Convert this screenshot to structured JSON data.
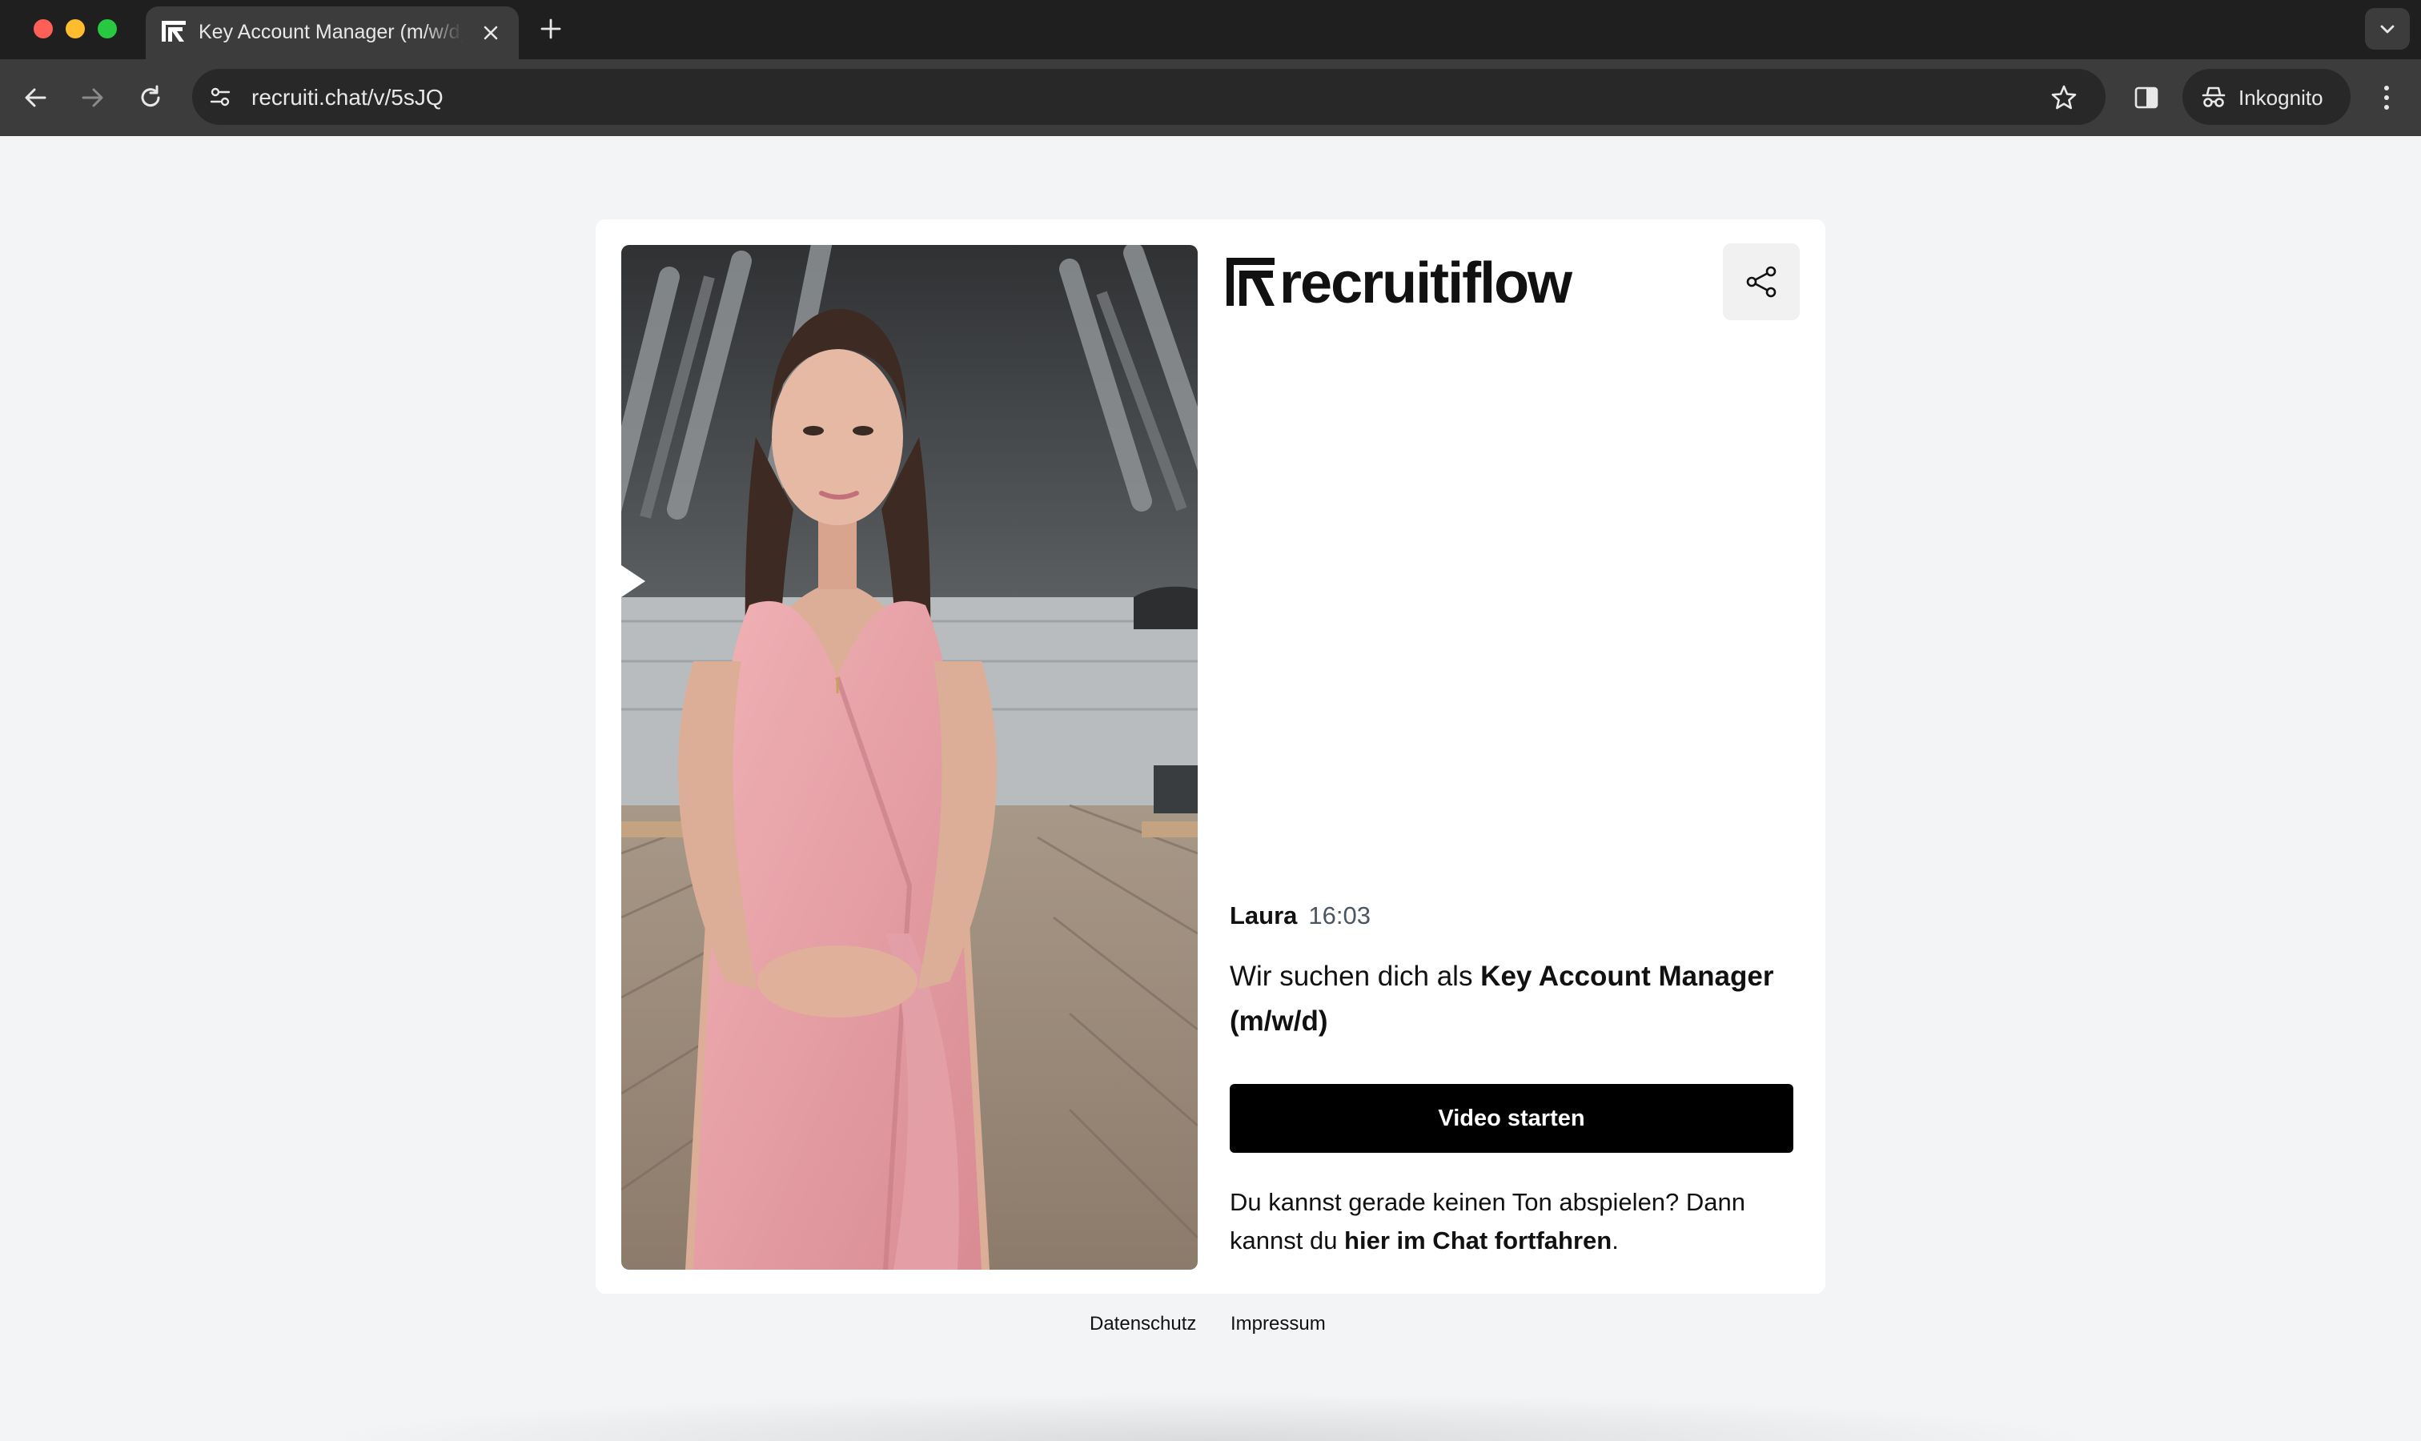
{
  "browser": {
    "tab": {
      "title": "Key Account Manager (m/w/d)"
    },
    "address_bar": {
      "url": "recruiti.chat/v/5sJQ"
    },
    "profile": {
      "label": "Inkognito"
    }
  },
  "page": {
    "logo": {
      "text": "recruitiflow",
      "icon": "recruitiflow-logo-mark"
    },
    "message": {
      "sender": "Laura",
      "time": "16:03",
      "text_prefix": "Wir suchen dich als ",
      "job_title": "Key Account Manager (m/w/d)"
    },
    "start_button": {
      "label": "Video starten"
    },
    "hint": {
      "prefix": "Du kannst gerade keinen Ton abspielen? Dann kannst du ",
      "link": "hier im Chat fortfahren",
      "suffix": "."
    },
    "footer": {
      "privacy_link": "Datenschutz",
      "imprint_link": "Impressum"
    }
  },
  "colors": {
    "page_background": "#f3f4f6",
    "button_background": "#000000",
    "dress_pink": "#e9a3a8"
  }
}
